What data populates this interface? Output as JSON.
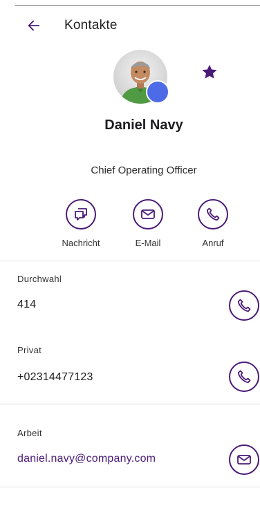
{
  "header": {
    "title": "Kontakte",
    "back_icon": "arrow-left-icon"
  },
  "contact": {
    "name": "Daniel Navy",
    "job_title": "Chief Operating Officer",
    "favorite": true,
    "presence_color": "#4d6be6"
  },
  "actions": [
    {
      "label": "Nachricht",
      "icon": "message-icon"
    },
    {
      "label": "E-Mail",
      "icon": "mail-icon"
    },
    {
      "label": "Anruf",
      "icon": "phone-icon"
    }
  ],
  "fields": {
    "extension": {
      "label": "Durchwahl",
      "value": "414",
      "icon": "phone-icon"
    },
    "private": {
      "label": "Privat",
      "value": "+02314477123",
      "icon": "phone-icon"
    },
    "work": {
      "label": "Arbeit",
      "value": "daniel.navy@company.com",
      "icon": "mail-icon"
    }
  },
  "colors": {
    "accent": "#4a1a77",
    "divider": "#e4e4e4"
  }
}
